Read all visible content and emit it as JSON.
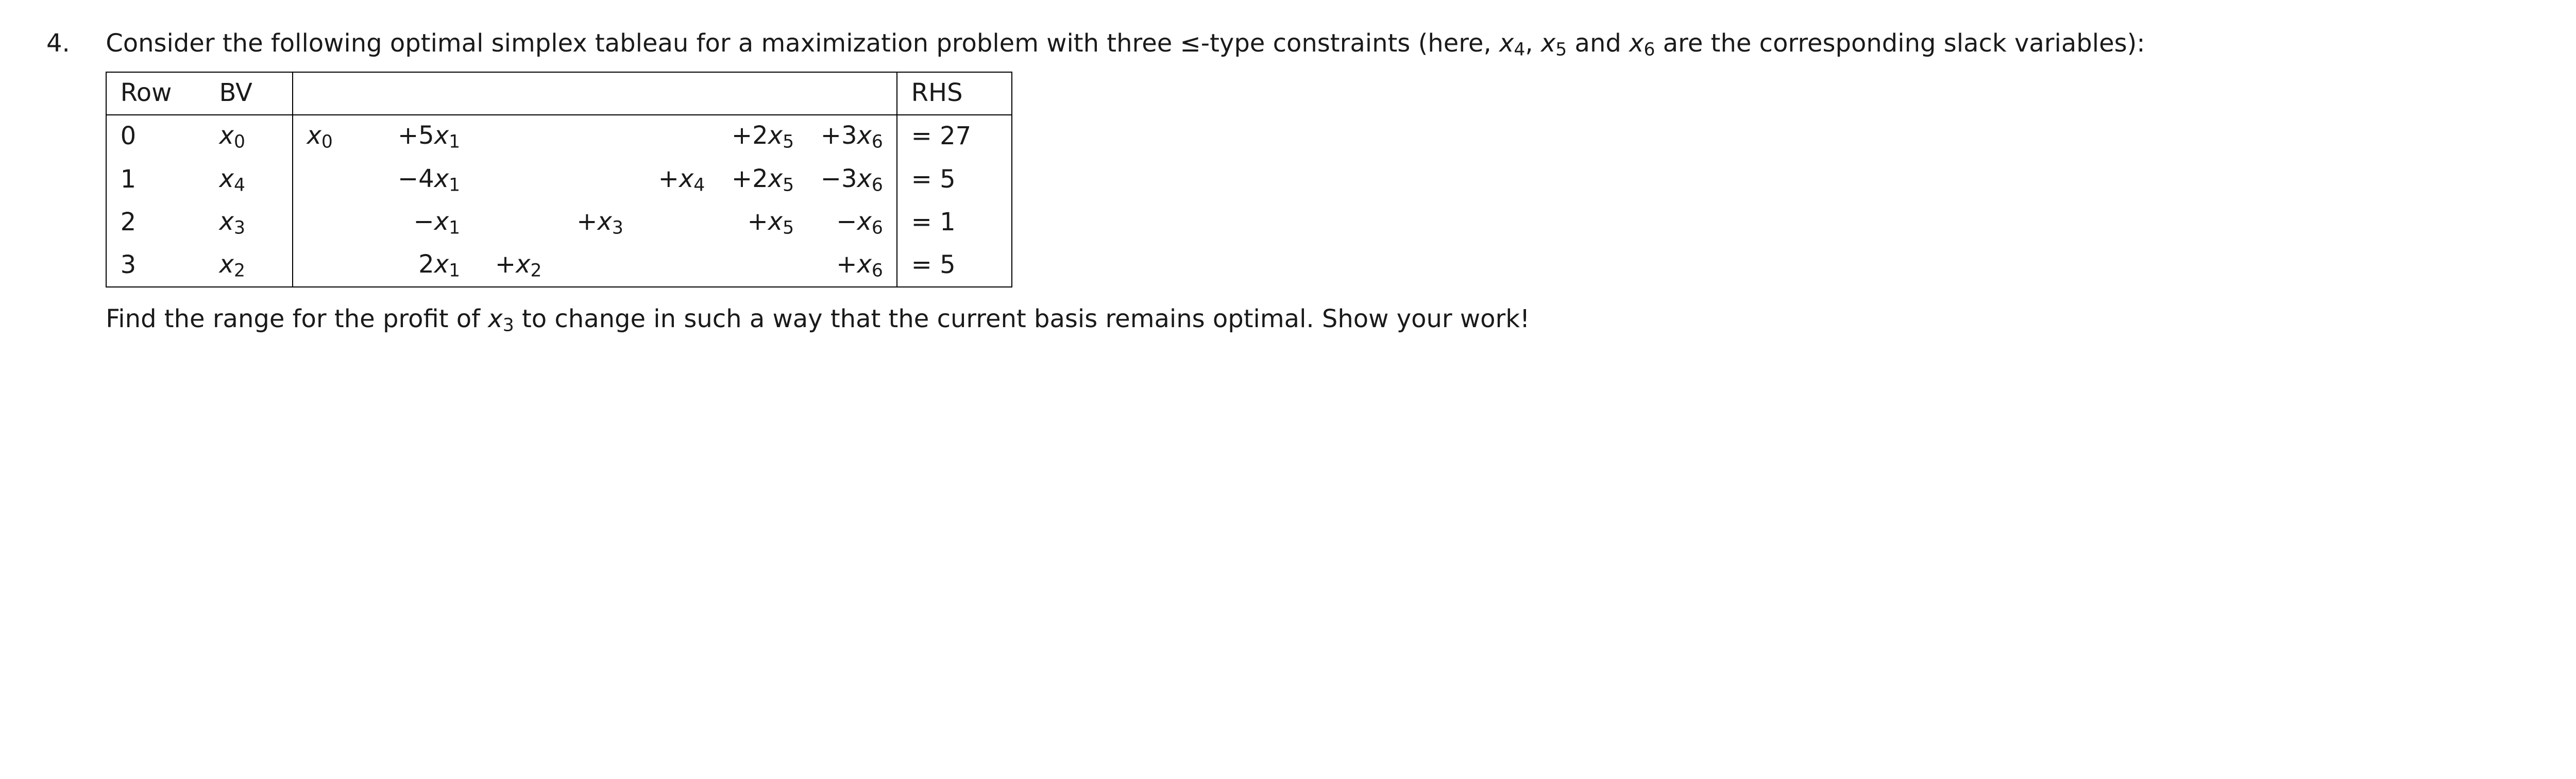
{
  "question": {
    "number": "4.",
    "intro_text_parts": {
      "p1": "Consider the following optimal simplex tableau for a maximization problem with three ",
      "le_symbol": "≤",
      "p2": "-type constraints (here, ",
      "p3": ", ",
      "p4": " and ",
      "p5": " are the corresponding slack variables):"
    },
    "vars": {
      "x4": "x",
      "x4_sub": "4",
      "x5": "x",
      "x5_sub": "5",
      "x6": "x",
      "x6_sub": "6",
      "x3": "x",
      "x3_sub": "3"
    },
    "tableau": {
      "headers": {
        "row": "Row",
        "bv": "BV",
        "rhs": "RHS"
      },
      "rows": [
        {
          "row": "0",
          "bv_var": "x",
          "bv_sub": "0",
          "terms": {
            "x0": {
              "sign": "",
              "coef": "",
              "var": "x",
              "sub": "0"
            },
            "x1": {
              "sign": "+",
              "coef": "5",
              "var": "x",
              "sub": "1"
            },
            "x2": null,
            "x3": null,
            "x4": null,
            "x5": {
              "sign": "+",
              "coef": "2",
              "var": "x",
              "sub": "5"
            },
            "x6": {
              "sign": "+",
              "coef": "3",
              "var": "x",
              "sub": "6"
            }
          },
          "rhs": "= 27"
        },
        {
          "row": "1",
          "bv_var": "x",
          "bv_sub": "4",
          "terms": {
            "x0": null,
            "x1": {
              "sign": "−",
              "coef": "4",
              "var": "x",
              "sub": "1"
            },
            "x2": null,
            "x3": null,
            "x4": {
              "sign": "+",
              "coef": "",
              "var": "x",
              "sub": "4"
            },
            "x5": {
              "sign": "+",
              "coef": "2",
              "var": "x",
              "sub": "5"
            },
            "x6": {
              "sign": "−",
              "coef": "3",
              "var": "x",
              "sub": "6"
            }
          },
          "rhs": "= 5"
        },
        {
          "row": "2",
          "bv_var": "x",
          "bv_sub": "3",
          "terms": {
            "x0": null,
            "x1": {
              "sign": "−",
              "coef": "",
              "var": "x",
              "sub": "1"
            },
            "x2": null,
            "x3": {
              "sign": "+",
              "coef": "",
              "var": "x",
              "sub": "3"
            },
            "x4": null,
            "x5": {
              "sign": "+",
              "coef": "",
              "var": "x",
              "sub": "5"
            },
            "x6": {
              "sign": "−",
              "coef": "",
              "var": "x",
              "sub": "6"
            }
          },
          "rhs": "= 1"
        },
        {
          "row": "3",
          "bv_var": "x",
          "bv_sub": "2",
          "terms": {
            "x0": null,
            "x1": {
              "sign": "",
              "coef": "2",
              "var": "x",
              "sub": "1"
            },
            "x2": {
              "sign": "+",
              "coef": "",
              "var": "x",
              "sub": "2"
            },
            "x3": null,
            "x4": null,
            "x5": null,
            "x6": {
              "sign": "+",
              "coef": "",
              "var": "x",
              "sub": "6"
            }
          },
          "rhs": "= 5"
        }
      ]
    },
    "closing_text": {
      "p1": "Find the range for the profit of ",
      "p2": " to change in such a way that the current basis remains optimal. Show your work!"
    }
  }
}
